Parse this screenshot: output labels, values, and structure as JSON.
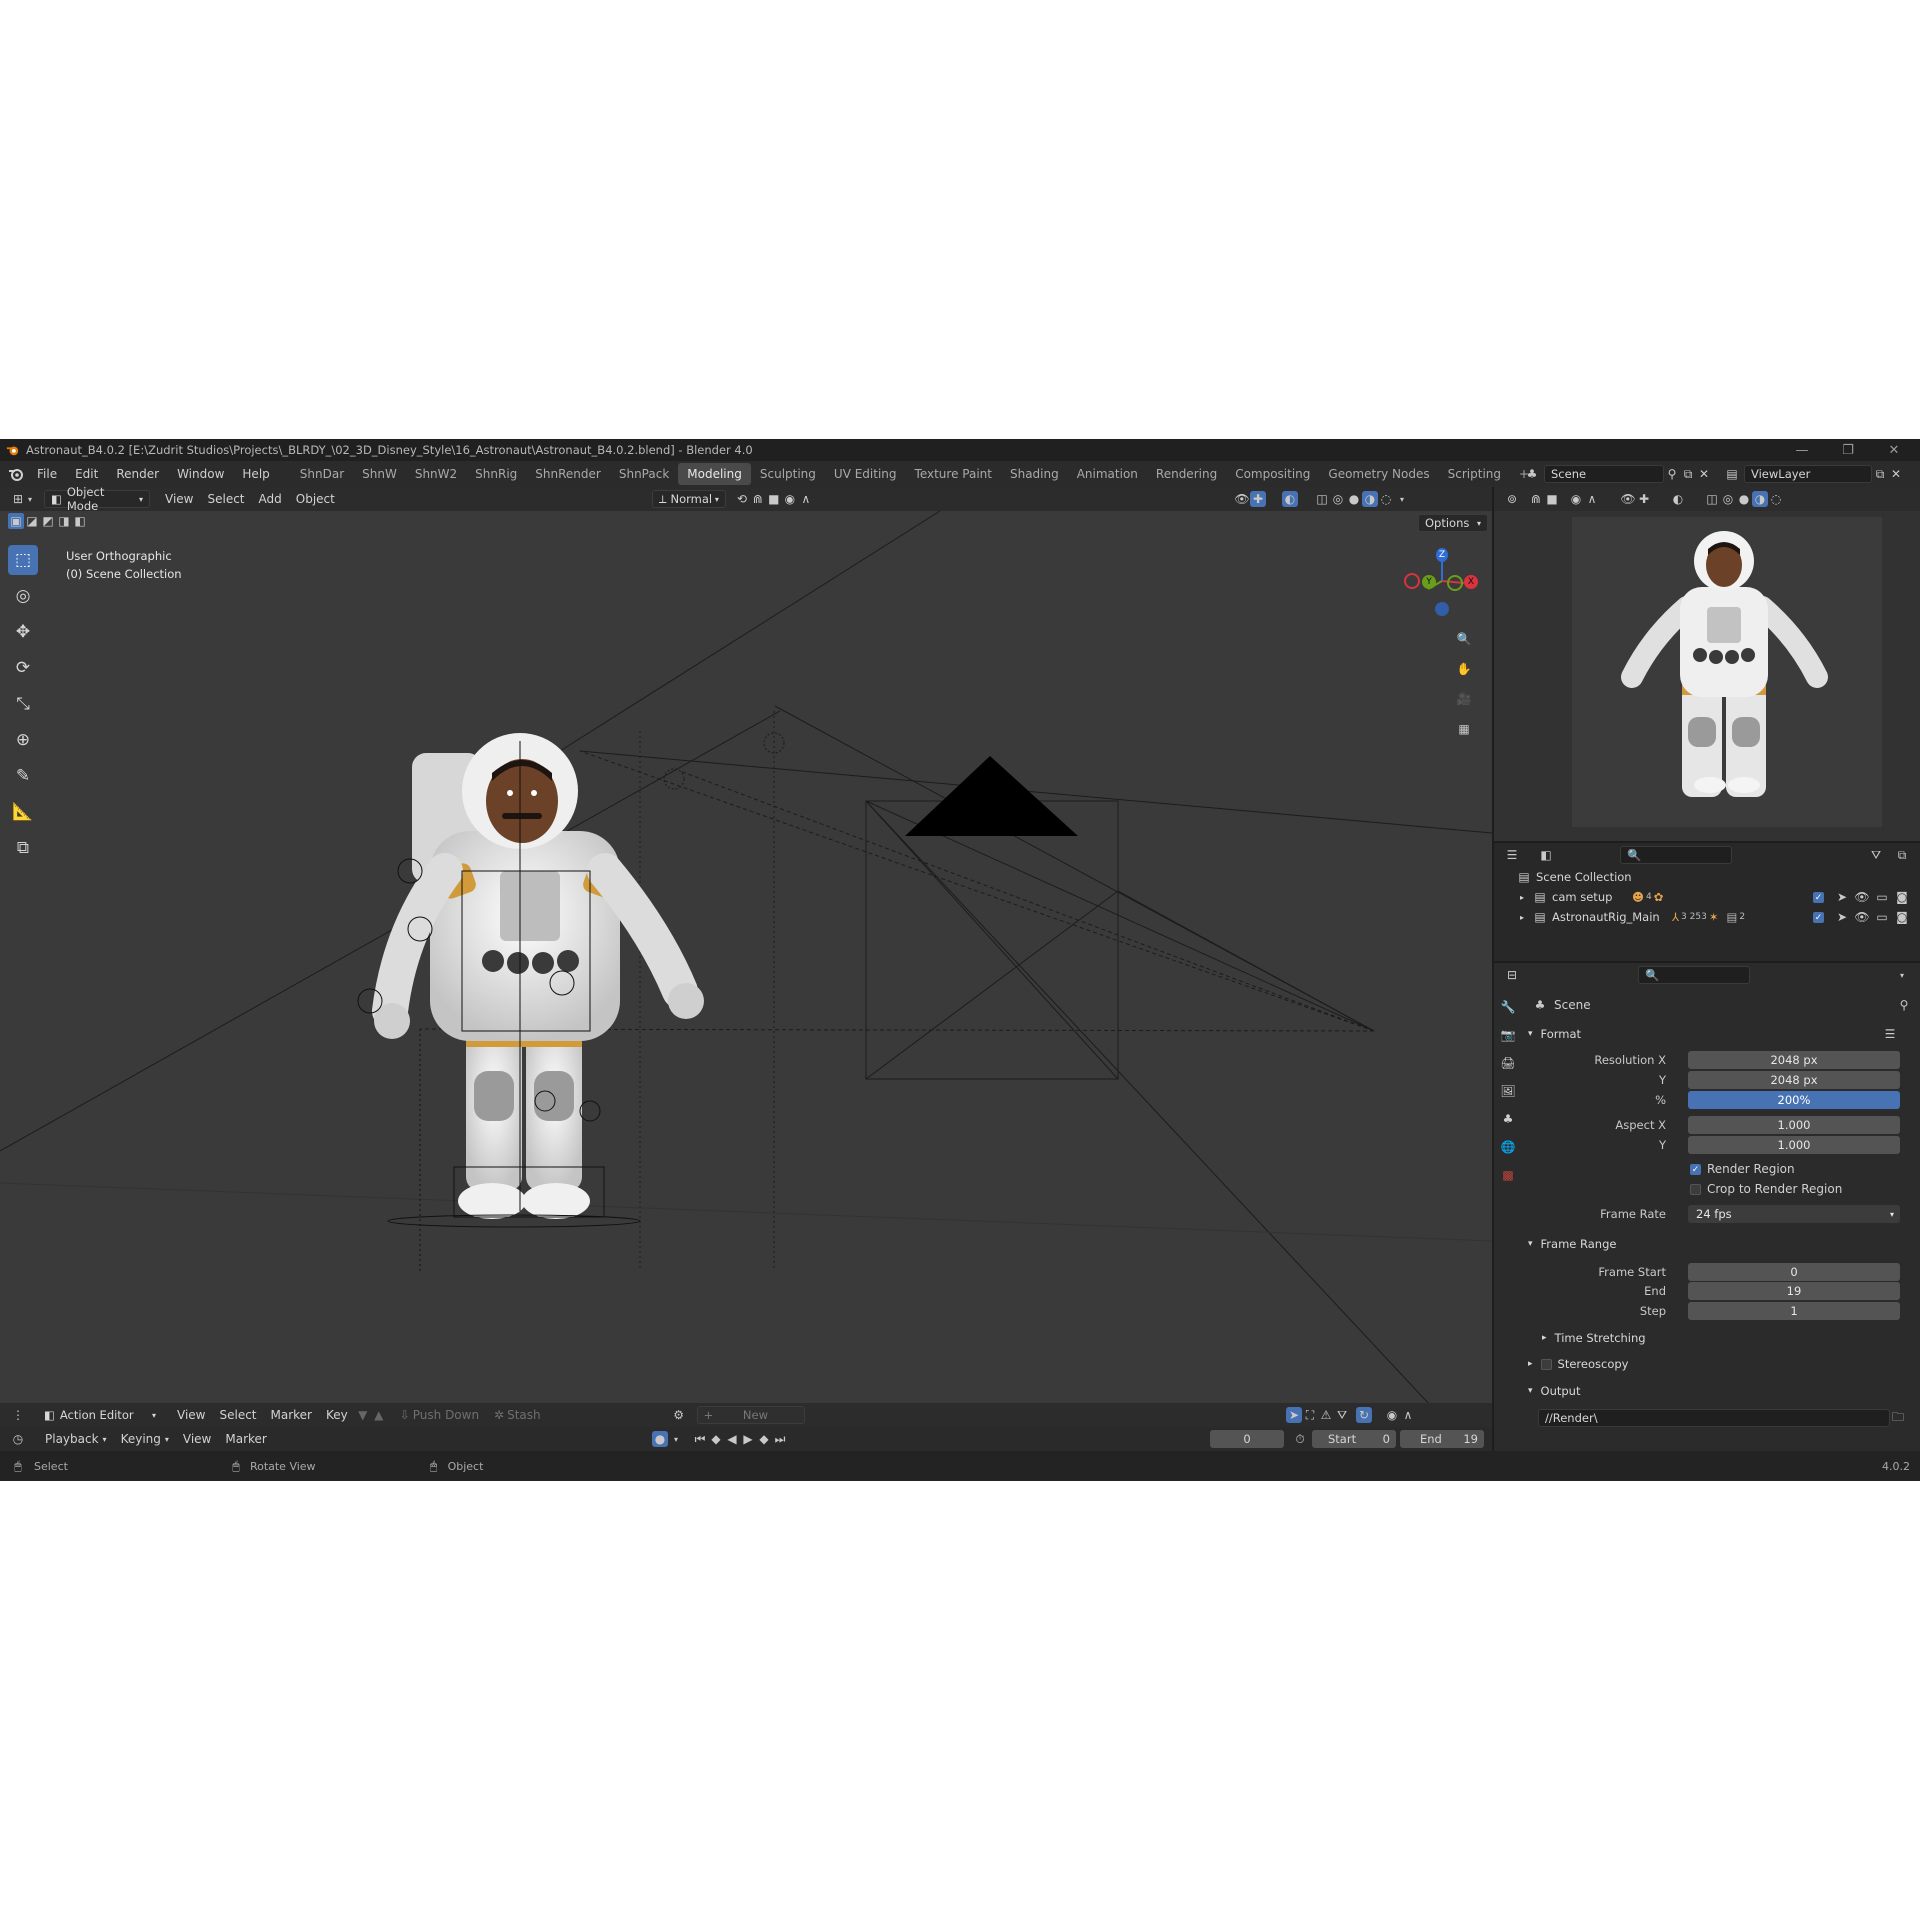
{
  "window": {
    "title": "Astronaut_B4.0.2 [E:\\Zudrit Studios\\Projects\\_BLRDY_\\02_3D_Disney_Style\\16_Astronaut\\Astronaut_B4.0.2.blend] - Blender 4.0",
    "minimize": "—",
    "restore": "❐",
    "close": "✕"
  },
  "menubar": {
    "items": [
      "File",
      "Edit",
      "Render",
      "Window",
      "Help"
    ]
  },
  "workspaces": {
    "tabs": [
      "ShnDar",
      "ShnW",
      "ShnW2",
      "ShnRig",
      "ShnRender",
      "ShnPack",
      "Modeling",
      "Sculpting",
      "UV Editing",
      "Texture Paint",
      "Shading",
      "Animation",
      "Rendering",
      "Compositing",
      "Geometry Nodes",
      "Scripting"
    ],
    "active": "Modeling",
    "add": "+"
  },
  "scene_selector": {
    "value": "Scene"
  },
  "viewlayer_selector": {
    "value": "ViewLayer"
  },
  "viewport_header": {
    "mode": "Object Mode",
    "menus": [
      "View",
      "Select",
      "Add",
      "Object"
    ],
    "orientation": "Normal",
    "options": "Options"
  },
  "viewport": {
    "view_name": "User Orthographic",
    "collection": "(0) Scene Collection",
    "gizmo": {
      "z": "Z",
      "y": "Y",
      "x": "X",
      "z_color": "#2f6ed6",
      "y_color": "#6a9e1a",
      "x_color": "#d8343f"
    }
  },
  "tools": [
    {
      "name": "select-box-icon",
      "glyph": "⬚",
      "active": true
    },
    {
      "name": "cursor-icon",
      "glyph": "◎",
      "active": false
    },
    {
      "name": "move-icon",
      "glyph": "✥",
      "active": false
    },
    {
      "name": "rotate-icon",
      "glyph": "⟳",
      "active": false
    },
    {
      "name": "scale-icon",
      "glyph": "⤡",
      "active": false
    },
    {
      "name": "transform-icon",
      "glyph": "⊕",
      "active": false
    },
    {
      "name": "annotate-icon",
      "glyph": "✎",
      "active": false
    },
    {
      "name": "measure-icon",
      "glyph": "📐",
      "active": false
    },
    {
      "name": "add-cube-icon",
      "glyph": "⧉",
      "active": false
    }
  ],
  "outliner": {
    "root": "Scene Collection",
    "rows": [
      {
        "label": "cam setup",
        "badge": "4"
      },
      {
        "label": "AstronautRig_Main",
        "badge": "3 253",
        "badge2": "2"
      }
    ]
  },
  "properties": {
    "context": "Scene",
    "format": {
      "header": "Format",
      "resolution_x_label": "Resolution X",
      "resolution_x": "2048 px",
      "y_label": "Y",
      "resolution_y": "2048 px",
      "percent_label": "%",
      "percent": "200%",
      "aspect_x_label": "Aspect X",
      "aspect_x": "1.000",
      "aspect_y_label": "Y",
      "aspect_y": "1.000",
      "render_region": "Render Region",
      "crop_region": "Crop to Render Region",
      "frame_rate_label": "Frame Rate",
      "frame_rate": "24 fps"
    },
    "frame_range": {
      "header": "Frame Range",
      "start_label": "Frame Start",
      "start": "0",
      "end_label": "End",
      "end": "19",
      "step_label": "Step",
      "step": "1"
    },
    "time_stretching": "Time Stretching",
    "stereoscopy": "Stereoscopy",
    "output": {
      "header": "Output",
      "path": "//Render\\"
    }
  },
  "action_editor": {
    "mode": "Action Editor",
    "menus": [
      "View",
      "Select",
      "Marker",
      "Key"
    ],
    "push_down": "Push Down",
    "stash": "Stash",
    "new": "New"
  },
  "timeline": {
    "menus": [
      "Playback",
      "Keying",
      "View",
      "Marker"
    ],
    "current_frame": "0",
    "start_label": "Start",
    "start": "0",
    "end_label": "End",
    "end": "19"
  },
  "statusbar": {
    "select": "Select",
    "rotate": "Rotate View",
    "object": "Object",
    "version": "4.0.2"
  }
}
